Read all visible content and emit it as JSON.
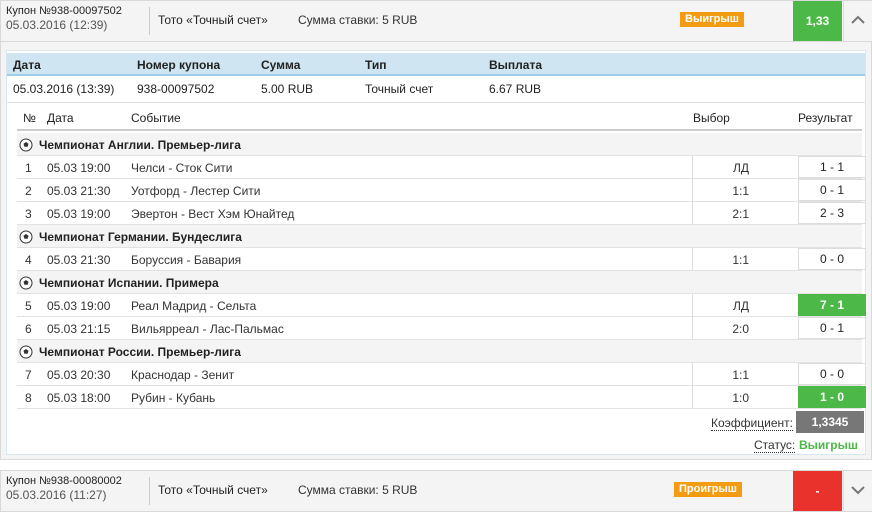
{
  "coupon1": {
    "id_label": "Купон №938-00097502",
    "date": "05.03.2016 (12:39)",
    "type": "Тото «Точный счет»",
    "stake": "Сумма ставки: 5 RUB",
    "badge": "Выигрыш",
    "badge_color": "#f39c12",
    "coef": "1,33",
    "coef_color": "#4cb848",
    "toggle_icon": "chevron-up-icon"
  },
  "summary": {
    "headers": [
      "Дата",
      "Номер купона",
      "Сумма",
      "Тип",
      "Выплата"
    ],
    "values": [
      "05.03.2016 (13:39)",
      "938-00097502",
      "5.00 RUB",
      "Точный счет",
      "6.67 RUB"
    ]
  },
  "events_table": {
    "headers": {
      "num": "№",
      "date": "Дата",
      "event": "Событие",
      "choice": "Выбор",
      "result": "Результат"
    },
    "groups": [
      "Чемпионат Англии. Премьер-лига",
      "Чемпионат Германии. Бундеслига",
      "Чемпионат Испании. Примера",
      "Чемпионат России. Премьер-лига"
    ],
    "rows": [
      {
        "num": "1",
        "date": "05.03 19:00",
        "event": "Челси - Сток Сити",
        "choice": "ЛД",
        "result": "1 - 1",
        "win": false
      },
      {
        "num": "2",
        "date": "05.03 21:30",
        "event": "Уотфорд - Лестер Сити",
        "choice": "1:1",
        "result": "0 - 1",
        "win": false
      },
      {
        "num": "3",
        "date": "05.03 19:00",
        "event": "Эвертон - Вест Хэм Юнайтед",
        "choice": "2:1",
        "result": "2 - 3",
        "win": false
      },
      {
        "num": "4",
        "date": "05.03 21:30",
        "event": "Боруссия - Бавария",
        "choice": "1:1",
        "result": "0 - 0",
        "win": false
      },
      {
        "num": "5",
        "date": "05.03 19:00",
        "event": "Реал Мадрид - Сельта",
        "choice": "ЛД",
        "result": "7 - 1",
        "win": true
      },
      {
        "num": "6",
        "date": "05.03 21:15",
        "event": "Вильярреал - Лас-Пальмас",
        "choice": "2:0",
        "result": "0 - 1",
        "win": false
      },
      {
        "num": "7",
        "date": "05.03 20:30",
        "event": "Краснодар - Зенит",
        "choice": "1:1",
        "result": "0 - 0",
        "win": false
      },
      {
        "num": "8",
        "date": "05.03 18:00",
        "event": "Рубин - Кубань",
        "choice": "1:0",
        "result": "1 - 0",
        "win": true
      }
    ],
    "coef_label": "Коэффициент:",
    "coef_value": "1,3345",
    "status_label": "Статус:",
    "status_value": "Выигрыш",
    "status_color": "#4cb848",
    "sport_icon": "soccer-ball-icon"
  },
  "coupon2": {
    "id_label": "Купон №938-00080002",
    "date": "05.03.2016 (11:27)",
    "type": "Тото «Точный счет»",
    "stake": "Сумма ставки: 5 RUB",
    "badge": "Проигрыш",
    "badge_color": "#f39c12",
    "coef": "-",
    "coef_color": "#e8322b",
    "toggle_icon": "chevron-down-icon"
  }
}
